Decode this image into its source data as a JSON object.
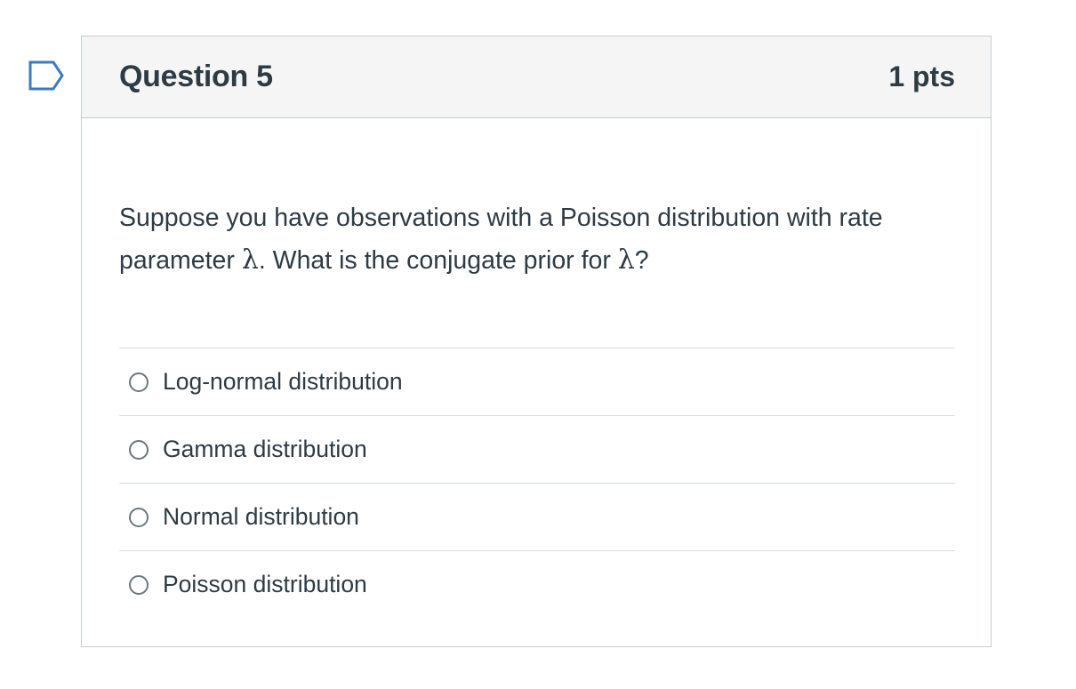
{
  "question": {
    "title": "Question 5",
    "points": "1 pts",
    "text_before": "Suppose you have observations with a Poisson distribution with rate parameter ",
    "symbol": "λ",
    "text_middle": ". What is the conjugate prior for ",
    "text_after": "?",
    "answers": [
      {
        "label": "Log-normal distribution"
      },
      {
        "label": "Gamma distribution"
      },
      {
        "label": "Normal distribution"
      },
      {
        "label": "Poisson distribution"
      }
    ]
  },
  "icons": {
    "flag": "bookmark-flag-icon"
  },
  "colors": {
    "flag_stroke": "#3b7bbf",
    "text": "#2d3b45",
    "header_bg": "#f5f5f5",
    "border": "#c7cdd1"
  }
}
